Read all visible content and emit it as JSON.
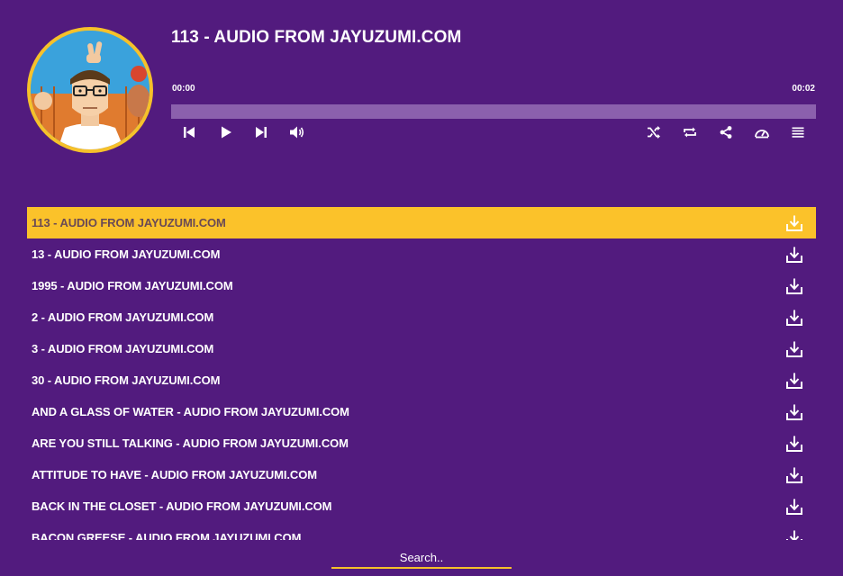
{
  "player": {
    "title": "113 - AUDIO FROM JAYUZUMI.COM",
    "current_time": "00:00",
    "total_time": "00:02",
    "progress_fraction": 0.0,
    "controls": {
      "previous": "skip-previous-icon",
      "play": "play-icon",
      "next": "skip-next-icon",
      "volume": "volume-icon",
      "shuffle": "shuffle-icon",
      "repeat": "repeat-icon",
      "share": "share-icon",
      "speed": "speedometer-icon",
      "playlist": "playlist-icon"
    }
  },
  "playlist": {
    "active_index": 0,
    "tracks": [
      "113 - AUDIO FROM JAYUZUMI.COM",
      "13 - AUDIO FROM JAYUZUMI.COM",
      "1995 - AUDIO FROM JAYUZUMI.COM",
      "2 - AUDIO FROM JAYUZUMI.COM",
      "3 - AUDIO FROM JAYUZUMI.COM",
      "30 - AUDIO FROM JAYUZUMI.COM",
      "AND A GLASS OF WATER - AUDIO FROM JAYUZUMI.COM",
      "ARE YOU STILL TALKING - AUDIO FROM JAYUZUMI.COM",
      "ATTITUDE TO HAVE - AUDIO FROM JAYUZUMI.COM",
      "BACK IN THE CLOSET - AUDIO FROM JAYUZUMI.COM",
      "BACON GREESE - AUDIO FROM JAYUZUMI.COM"
    ],
    "download_icon": "download-icon"
  },
  "search": {
    "placeholder": "Search.."
  },
  "colors": {
    "background": "#521b7e",
    "accent": "#fbc22a",
    "progress_track": "#8b60ad"
  }
}
